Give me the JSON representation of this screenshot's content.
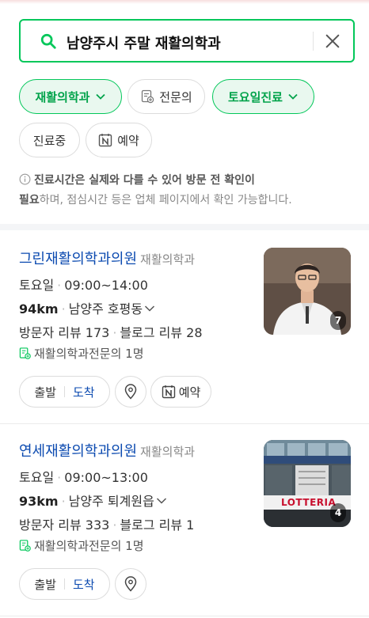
{
  "search": {
    "query": "남양주시 주말 재활의학과"
  },
  "filters": [
    {
      "label": "재활의학과",
      "active": true
    },
    {
      "label": "전문의",
      "active": false
    },
    {
      "label": "토요일진료",
      "active": true
    },
    {
      "label": "진료중",
      "active": false
    },
    {
      "label": "예약",
      "active": false
    }
  ],
  "notice": {
    "bold1": "진료시간은 실제와 다를 수 있어 방문 전 확인이",
    "bold2": "필요",
    "rest": "하며, 점심시간 등은 업체 페이지에서 확인 가능합니다."
  },
  "places": [
    {
      "name": "그린재활의학과의원",
      "category": "재활의학과",
      "day": "토요일",
      "hours": "09:00~14:00",
      "distance": "94km",
      "area": "남양주 호평동",
      "visitor_reviews": "방문자 리뷰 173",
      "blog_reviews": "블로그 리뷰 28",
      "specialist": "재활의학과전문의 1명",
      "photo_count": "7",
      "depart": "출발",
      "arrive": "도착",
      "reserve": "예약"
    },
    {
      "name": "연세재활의학과의원",
      "category": "재활의학과",
      "day": "토요일",
      "hours": "09:00~13:00",
      "distance": "93km",
      "area": "남양주 퇴계원읍",
      "visitor_reviews": "방문자 리뷰 333",
      "blog_reviews": "블로그 리뷰 1",
      "specialist": "재활의학과전문의 1명",
      "photo_count": "4",
      "photo_sign": "LOTTERIA",
      "depart": "출발",
      "arrive": "도착"
    }
  ],
  "colors": {
    "brand_green": "#03c75a",
    "link_blue": "#0b4ab0"
  }
}
